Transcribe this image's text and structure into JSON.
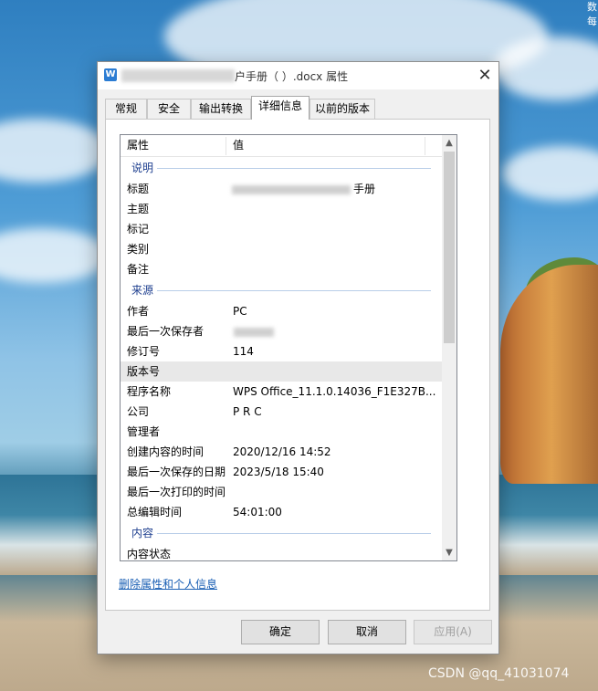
{
  "desktop": {
    "corner_top": "数",
    "corner_bottom": "每"
  },
  "dialog": {
    "title_suffix": "户手册（  ）.docx 属性",
    "close_glyph": "✕",
    "app_icon_glyph": "W",
    "tabs": [
      {
        "label": "常规"
      },
      {
        "label": "安全"
      },
      {
        "label": "输出转换"
      },
      {
        "label": "详细信息",
        "active": true
      },
      {
        "label": "以前的版本"
      }
    ],
    "list": {
      "headers": {
        "property": "属性",
        "value": "值"
      },
      "groups": {
        "description": "说明",
        "origin": "来源",
        "content": "内容"
      },
      "description_rows": [
        {
          "key": "标题",
          "value": "手册"
        },
        {
          "key": "主题",
          "value": ""
        },
        {
          "key": "标记",
          "value": ""
        },
        {
          "key": "类别",
          "value": ""
        },
        {
          "key": "备注",
          "value": ""
        }
      ],
      "origin_rows": [
        {
          "key": "作者",
          "value": "PC"
        },
        {
          "key": "最后一次保存者",
          "value": ""
        },
        {
          "key": "修订号",
          "value": "114"
        },
        {
          "key": "版本号",
          "value": ""
        },
        {
          "key": "程序名称",
          "value": "WPS Office_11.1.0.14036_F1E327B..."
        },
        {
          "key": "公司",
          "value": "P R C"
        },
        {
          "key": "管理者",
          "value": ""
        },
        {
          "key": "创建内容的时间",
          "value": "2020/12/16 14:52"
        },
        {
          "key": "最后一次保存的日期",
          "value": "2023/5/18 15:40"
        },
        {
          "key": "最后一次打印的时间",
          "value": ""
        },
        {
          "key": "总编辑时间",
          "value": "54:01:00"
        }
      ],
      "content_rows": [
        {
          "key": "内容状态",
          "value": ""
        }
      ]
    },
    "remove_link": "删除属性和个人信息",
    "buttons": {
      "ok": "确定",
      "cancel": "取消",
      "apply": "应用(A)"
    }
  },
  "watermark": "CSDN @qq_41031074"
}
